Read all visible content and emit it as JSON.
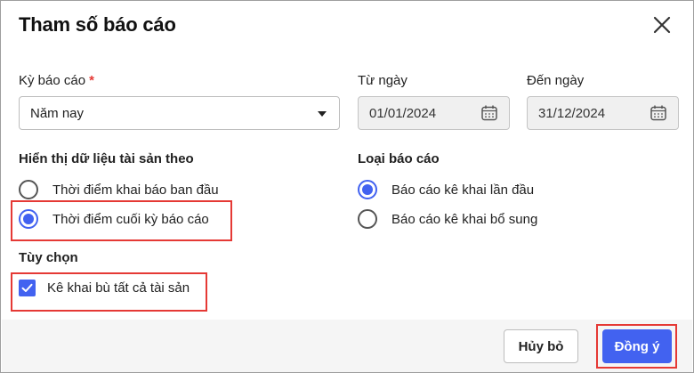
{
  "dialog": {
    "title": "Tham số báo cáo",
    "close_icon": "close-icon"
  },
  "period": {
    "label": "Kỳ báo cáo",
    "required_mark": "*",
    "selected": "Năm nay"
  },
  "from_date": {
    "label": "Từ ngày",
    "value": "01/01/2024",
    "icon": "calendar-icon"
  },
  "to_date": {
    "label": "Đến ngày",
    "value": "31/12/2024",
    "icon": "calendar-icon"
  },
  "display_by": {
    "label": "Hiển thị dữ liệu tài sản theo",
    "options": [
      {
        "label": "Thời điểm khai báo ban đầu",
        "selected": false
      },
      {
        "label": "Thời điểm cuối kỳ báo cáo",
        "selected": true
      }
    ]
  },
  "report_type": {
    "label": "Loại báo cáo",
    "options": [
      {
        "label": "Báo cáo kê khai lần đầu",
        "selected": true
      },
      {
        "label": "Báo cáo kê khai bổ sung",
        "selected": false
      }
    ]
  },
  "options_section": {
    "label": "Tùy chọn",
    "checkbox_label": "Kê khai bù tất cả tài sản",
    "checked": true
  },
  "footer": {
    "cancel_label": "Hủy bỏ",
    "ok_label": "Đồng ý"
  },
  "colors": {
    "accent": "#4262f0",
    "highlight": "#e53935",
    "required": "#e53935"
  }
}
